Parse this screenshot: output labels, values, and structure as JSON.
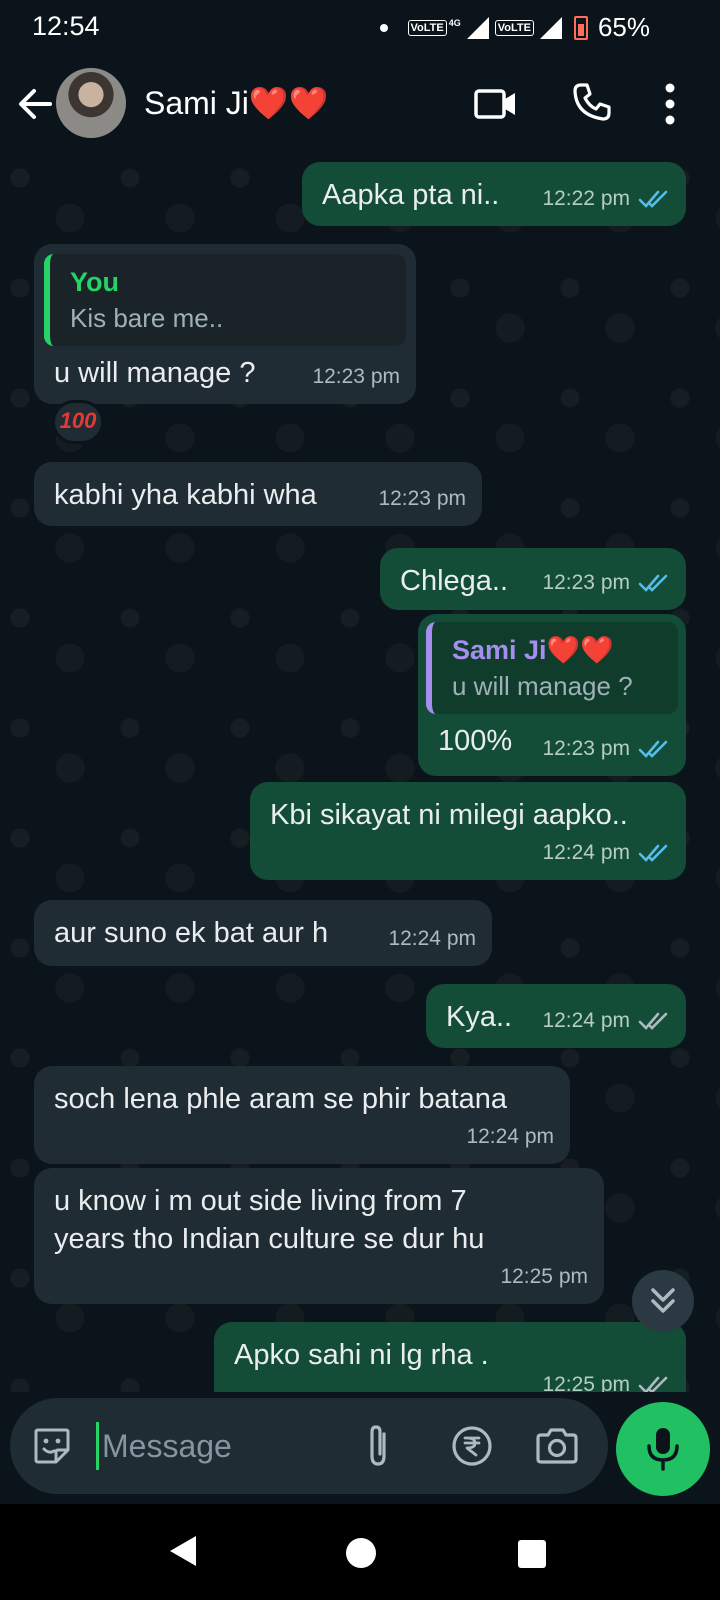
{
  "status_bar": {
    "time": "12:54",
    "volte1": "VoLTE",
    "network": "4G",
    "volte2": "VoLTE",
    "battery": "65%"
  },
  "header": {
    "contact_name": "Sami Ji❤️❤️"
  },
  "messages": [
    {
      "dir": "out",
      "text": "Aapka pta ni..",
      "time": "12:22 pm",
      "status": "read"
    },
    {
      "dir": "in",
      "reply_author": "You",
      "reply_text": "Kis bare me..",
      "text": "u will manage ?",
      "time": "12:23 pm",
      "reaction": "100"
    },
    {
      "dir": "in",
      "text": "kabhi yha kabhi wha",
      "time": "12:23 pm"
    },
    {
      "dir": "out",
      "text": "Chlega..",
      "time": "12:23 pm",
      "status": "read"
    },
    {
      "dir": "out",
      "reply_author": "Sami Ji❤️❤️",
      "reply_text": "u will manage ?",
      "text": "100%",
      "time": "12:23 pm",
      "status": "read"
    },
    {
      "dir": "out",
      "text": "Kbi sikayat ni milegi aapko..",
      "time": "12:24 pm",
      "status": "read"
    },
    {
      "dir": "in",
      "text": "aur suno ek bat aur h",
      "time": "12:24 pm"
    },
    {
      "dir": "out",
      "text": "Kya..",
      "time": "12:24 pm",
      "status": "delivered"
    },
    {
      "dir": "in",
      "text": "soch lena phle aram se phir batana",
      "time": "12:24 pm"
    },
    {
      "dir": "in",
      "text": "u know i  m out side living from 7\nyears tho Indian culture se dur hu",
      "time": "12:25 pm"
    },
    {
      "dir": "out",
      "text": "Apko sahi ni lg rha .",
      "time": "12:25 pm",
      "status": "delivered"
    }
  ],
  "composer": {
    "placeholder": "Message"
  },
  "colors": {
    "accent": "#25d366",
    "outgoing": "#144d37",
    "incoming": "#202c33",
    "read_tick": "#53bdeb"
  }
}
